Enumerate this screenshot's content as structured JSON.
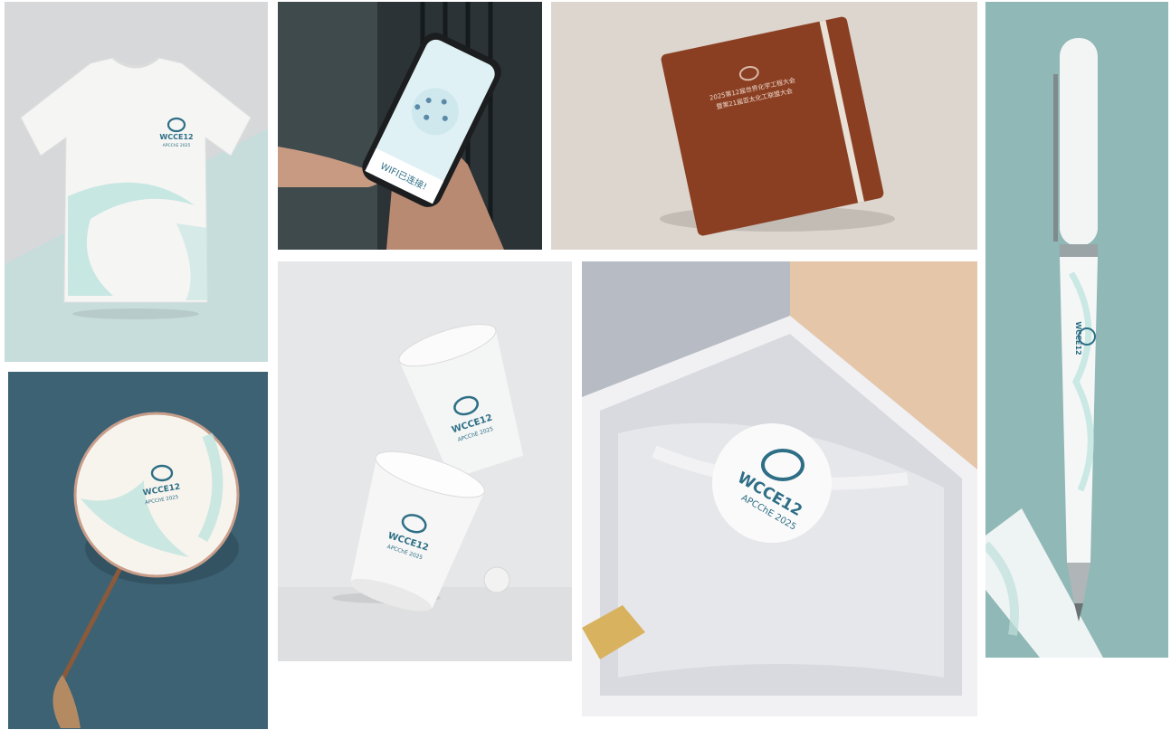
{
  "logo": {
    "wordmark": "WCCE12",
    "subtitle": "APCChE 2025"
  },
  "phone": {
    "banner_text": "WIFI已连接!"
  },
  "notebook": {
    "title_line1": "2025第12届世界化学工程大会",
    "title_line2": "暨第21届亚太化工联盟大会"
  },
  "colors": {
    "teal_logo": "#2e6f86",
    "mint": "#a9d6d3",
    "notebook_brown": "#8a3f22",
    "pen_bg": "#8fb8b6",
    "fan_bg": "#3d6274"
  }
}
